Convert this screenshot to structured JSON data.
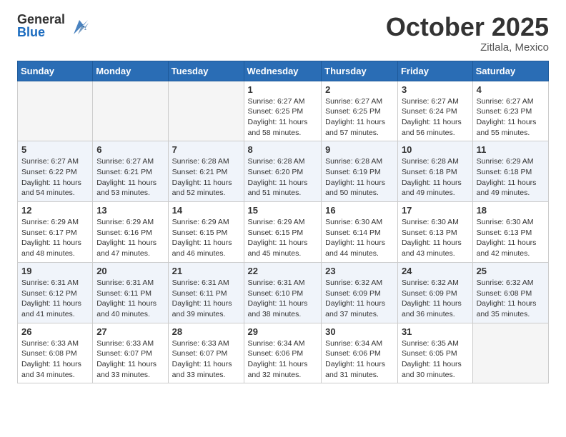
{
  "header": {
    "logo_general": "General",
    "logo_blue": "Blue",
    "month_title": "October 2025",
    "location": "Zitlala, Mexico"
  },
  "days_of_week": [
    "Sunday",
    "Monday",
    "Tuesday",
    "Wednesday",
    "Thursday",
    "Friday",
    "Saturday"
  ],
  "weeks": [
    [
      {
        "day": "",
        "info": ""
      },
      {
        "day": "",
        "info": ""
      },
      {
        "day": "",
        "info": ""
      },
      {
        "day": "1",
        "info": "Sunrise: 6:27 AM\nSunset: 6:25 PM\nDaylight: 11 hours\nand 58 minutes."
      },
      {
        "day": "2",
        "info": "Sunrise: 6:27 AM\nSunset: 6:25 PM\nDaylight: 11 hours\nand 57 minutes."
      },
      {
        "day": "3",
        "info": "Sunrise: 6:27 AM\nSunset: 6:24 PM\nDaylight: 11 hours\nand 56 minutes."
      },
      {
        "day": "4",
        "info": "Sunrise: 6:27 AM\nSunset: 6:23 PM\nDaylight: 11 hours\nand 55 minutes."
      }
    ],
    [
      {
        "day": "5",
        "info": "Sunrise: 6:27 AM\nSunset: 6:22 PM\nDaylight: 11 hours\nand 54 minutes."
      },
      {
        "day": "6",
        "info": "Sunrise: 6:27 AM\nSunset: 6:21 PM\nDaylight: 11 hours\nand 53 minutes."
      },
      {
        "day": "7",
        "info": "Sunrise: 6:28 AM\nSunset: 6:21 PM\nDaylight: 11 hours\nand 52 minutes."
      },
      {
        "day": "8",
        "info": "Sunrise: 6:28 AM\nSunset: 6:20 PM\nDaylight: 11 hours\nand 51 minutes."
      },
      {
        "day": "9",
        "info": "Sunrise: 6:28 AM\nSunset: 6:19 PM\nDaylight: 11 hours\nand 50 minutes."
      },
      {
        "day": "10",
        "info": "Sunrise: 6:28 AM\nSunset: 6:18 PM\nDaylight: 11 hours\nand 49 minutes."
      },
      {
        "day": "11",
        "info": "Sunrise: 6:29 AM\nSunset: 6:18 PM\nDaylight: 11 hours\nand 49 minutes."
      }
    ],
    [
      {
        "day": "12",
        "info": "Sunrise: 6:29 AM\nSunset: 6:17 PM\nDaylight: 11 hours\nand 48 minutes."
      },
      {
        "day": "13",
        "info": "Sunrise: 6:29 AM\nSunset: 6:16 PM\nDaylight: 11 hours\nand 47 minutes."
      },
      {
        "day": "14",
        "info": "Sunrise: 6:29 AM\nSunset: 6:15 PM\nDaylight: 11 hours\nand 46 minutes."
      },
      {
        "day": "15",
        "info": "Sunrise: 6:29 AM\nSunset: 6:15 PM\nDaylight: 11 hours\nand 45 minutes."
      },
      {
        "day": "16",
        "info": "Sunrise: 6:30 AM\nSunset: 6:14 PM\nDaylight: 11 hours\nand 44 minutes."
      },
      {
        "day": "17",
        "info": "Sunrise: 6:30 AM\nSunset: 6:13 PM\nDaylight: 11 hours\nand 43 minutes."
      },
      {
        "day": "18",
        "info": "Sunrise: 6:30 AM\nSunset: 6:13 PM\nDaylight: 11 hours\nand 42 minutes."
      }
    ],
    [
      {
        "day": "19",
        "info": "Sunrise: 6:31 AM\nSunset: 6:12 PM\nDaylight: 11 hours\nand 41 minutes."
      },
      {
        "day": "20",
        "info": "Sunrise: 6:31 AM\nSunset: 6:11 PM\nDaylight: 11 hours\nand 40 minutes."
      },
      {
        "day": "21",
        "info": "Sunrise: 6:31 AM\nSunset: 6:11 PM\nDaylight: 11 hours\nand 39 minutes."
      },
      {
        "day": "22",
        "info": "Sunrise: 6:31 AM\nSunset: 6:10 PM\nDaylight: 11 hours\nand 38 minutes."
      },
      {
        "day": "23",
        "info": "Sunrise: 6:32 AM\nSunset: 6:09 PM\nDaylight: 11 hours\nand 37 minutes."
      },
      {
        "day": "24",
        "info": "Sunrise: 6:32 AM\nSunset: 6:09 PM\nDaylight: 11 hours\nand 36 minutes."
      },
      {
        "day": "25",
        "info": "Sunrise: 6:32 AM\nSunset: 6:08 PM\nDaylight: 11 hours\nand 35 minutes."
      }
    ],
    [
      {
        "day": "26",
        "info": "Sunrise: 6:33 AM\nSunset: 6:08 PM\nDaylight: 11 hours\nand 34 minutes."
      },
      {
        "day": "27",
        "info": "Sunrise: 6:33 AM\nSunset: 6:07 PM\nDaylight: 11 hours\nand 33 minutes."
      },
      {
        "day": "28",
        "info": "Sunrise: 6:33 AM\nSunset: 6:07 PM\nDaylight: 11 hours\nand 33 minutes."
      },
      {
        "day": "29",
        "info": "Sunrise: 6:34 AM\nSunset: 6:06 PM\nDaylight: 11 hours\nand 32 minutes."
      },
      {
        "day": "30",
        "info": "Sunrise: 6:34 AM\nSunset: 6:06 PM\nDaylight: 11 hours\nand 31 minutes."
      },
      {
        "day": "31",
        "info": "Sunrise: 6:35 AM\nSunset: 6:05 PM\nDaylight: 11 hours\nand 30 minutes."
      },
      {
        "day": "",
        "info": ""
      }
    ]
  ]
}
